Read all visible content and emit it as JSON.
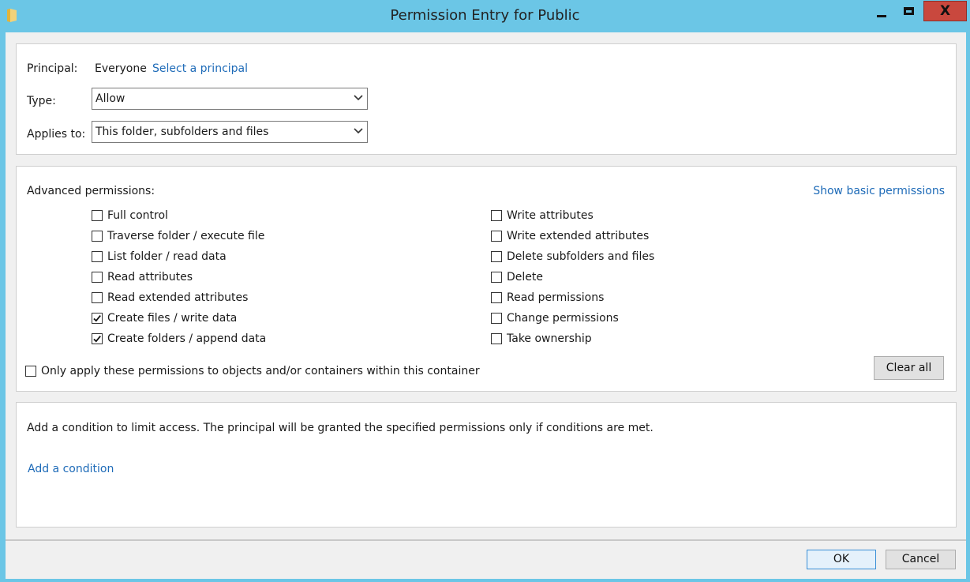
{
  "window": {
    "title": "Permission Entry for Public",
    "controls": {
      "minimize_icon": "minimize-icon",
      "maximize_icon": "maximize-icon",
      "close_glyph": "X"
    }
  },
  "principal": {
    "label": "Principal:",
    "value": "Everyone",
    "link": "Select a principal"
  },
  "type": {
    "label": "Type:",
    "selected": "Allow"
  },
  "applies_to": {
    "label": "Applies to:",
    "selected": "This folder, subfolders and files"
  },
  "advanced": {
    "heading": "Advanced permissions:",
    "toggle_link": "Show basic permissions",
    "left": [
      {
        "label": "Full control",
        "checked": false
      },
      {
        "label": "Traverse folder / execute file",
        "checked": false
      },
      {
        "label": "List folder / read data",
        "checked": false
      },
      {
        "label": "Read attributes",
        "checked": false
      },
      {
        "label": "Read extended attributes",
        "checked": false
      },
      {
        "label": "Create files / write data",
        "checked": true
      },
      {
        "label": "Create folders / append data",
        "checked": true
      }
    ],
    "right": [
      {
        "label": "Write attributes",
        "checked": false
      },
      {
        "label": "Write extended attributes",
        "checked": false
      },
      {
        "label": "Delete subfolders and files",
        "checked": false
      },
      {
        "label": "Delete",
        "checked": false
      },
      {
        "label": "Read permissions",
        "checked": false
      },
      {
        "label": "Change permissions",
        "checked": false
      },
      {
        "label": "Take ownership",
        "checked": false
      }
    ],
    "only_apply": {
      "label": "Only apply these permissions to objects and/or containers within this container",
      "checked": false
    },
    "clear_all": "Clear all"
  },
  "condition": {
    "text": "Add a condition to limit access. The principal will be granted the specified permissions only if conditions are met.",
    "link": "Add a condition"
  },
  "buttons": {
    "ok": "OK",
    "cancel": "Cancel"
  },
  "colors": {
    "titlebar": "#6bc6e6",
    "link": "#1e6bb8",
    "close": "#c9483e"
  }
}
